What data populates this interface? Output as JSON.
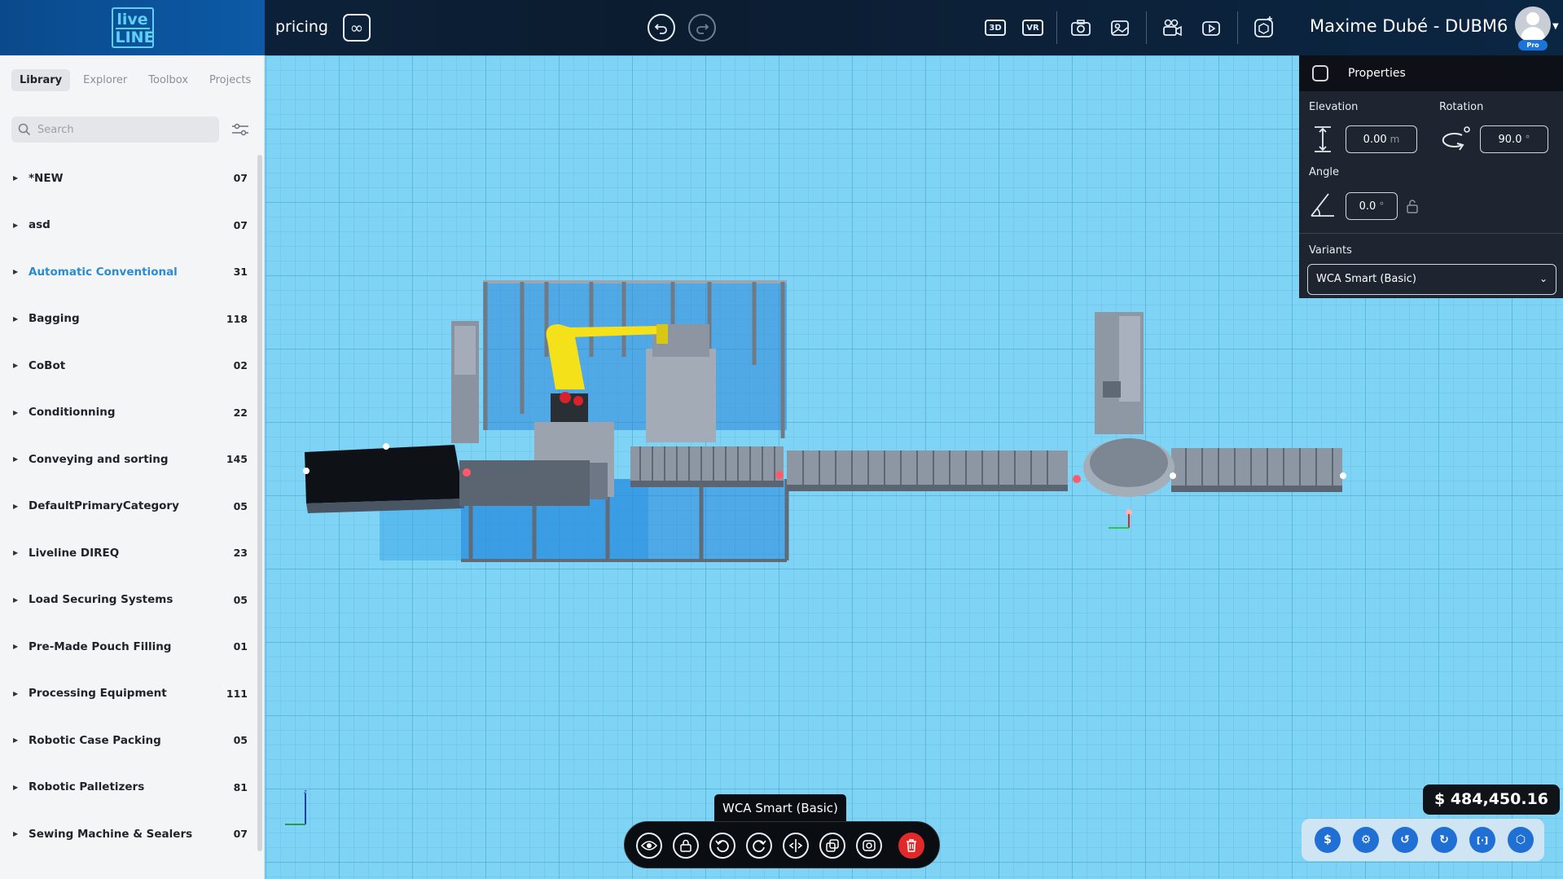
{
  "app": {
    "logo_line1": "live",
    "logo_line2": "LINE",
    "project_name": "pricing",
    "user_name": "Maxime Dubé - DUBM6",
    "plan_badge": "Pro"
  },
  "toolbar": {
    "view_3d": "3D",
    "view_vr": "VR"
  },
  "sidebar": {
    "tabs": [
      "Library",
      "Explorer",
      "Toolbox",
      "Projects"
    ],
    "active_tab": "Library",
    "search_placeholder": "Search",
    "categories": [
      {
        "label": "*NEW",
        "count": "07"
      },
      {
        "label": "asd",
        "count": "07"
      },
      {
        "label": "Automatic Conventional",
        "count": "31",
        "highlight": true
      },
      {
        "label": "Bagging",
        "count": "118"
      },
      {
        "label": "CoBot",
        "count": "02"
      },
      {
        "label": "Conditionning",
        "count": "22"
      },
      {
        "label": "Conveying and sorting",
        "count": "145"
      },
      {
        "label": "DefaultPrimaryCategory",
        "count": "05"
      },
      {
        "label": "Liveline DIREQ",
        "count": "23"
      },
      {
        "label": "Load Securing Systems",
        "count": "05"
      },
      {
        "label": "Pre-Made Pouch Filling",
        "count": "01"
      },
      {
        "label": "Processing Equipment",
        "count": "111"
      },
      {
        "label": "Robotic Case Packing",
        "count": "05"
      },
      {
        "label": "Robotic Palletizers",
        "count": "81"
      },
      {
        "label": "Sewing Machine & Sealers",
        "count": "07"
      }
    ]
  },
  "properties": {
    "title": "Properties",
    "elevation_label": "Elevation",
    "elevation_value": "0.00",
    "elevation_unit": "m",
    "rotation_label": "Rotation",
    "rotation_value": "90.0",
    "rotation_unit": "°",
    "angle_label": "Angle",
    "angle_value": "0.0",
    "angle_unit": "°",
    "variants_label": "Variants",
    "variants_value": "WCA Smart (Basic)"
  },
  "selection": {
    "name": "WCA Smart (Basic)"
  },
  "pricing": {
    "total": "$ 484,450.16"
  },
  "colors": {
    "accent": "#2b8bd0",
    "viewport_bg": "#7fd3f5",
    "delete": "#e02a2a",
    "robot": "#f5e11a"
  }
}
